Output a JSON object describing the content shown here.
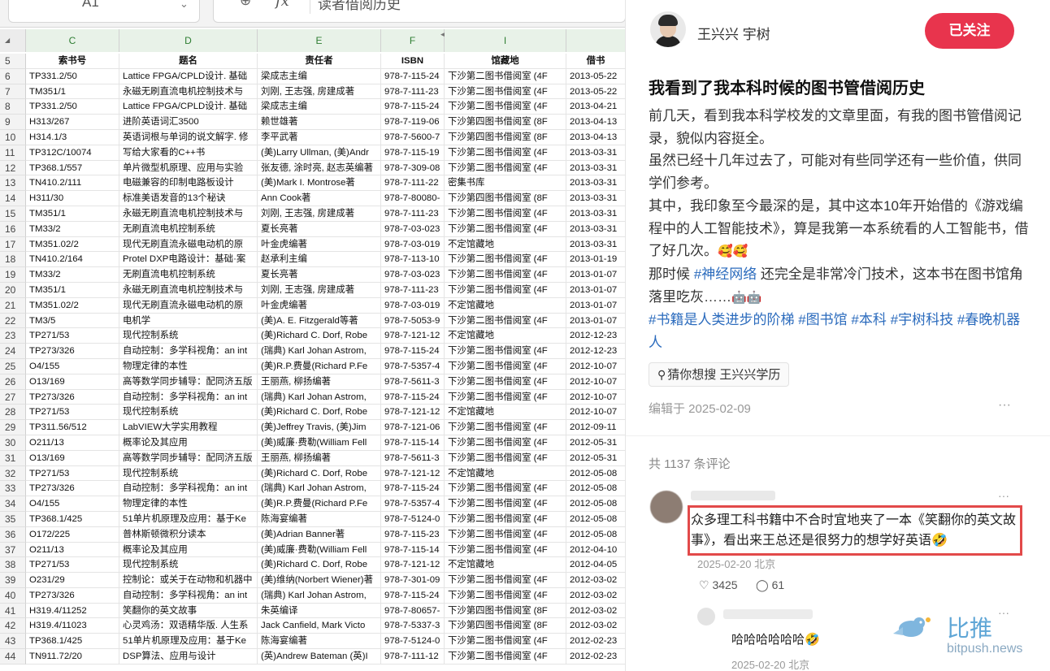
{
  "sheet": {
    "namebox": "A1",
    "formula_value": "读者借阅历史",
    "columns": [
      "C",
      "D",
      "E",
      "F",
      "I"
    ],
    "rows": [
      {
        "n": "5",
        "c": "索书号",
        "d": "题名",
        "e": "责任者",
        "f": "ISBN",
        "i": "馆藏地",
        "j": "借书"
      },
      {
        "n": "6",
        "c": "TP331.2/50",
        "d": "Lattice FPGA/CPLD设计. 基础",
        "e": "梁成志主编",
        "f": "978-7-115-24",
        "i": "下沙第二图书借阅室 (4F",
        "j": "2013-05-22"
      },
      {
        "n": "7",
        "c": "TM351/1",
        "d": "永磁无刷直流电机控制技术与",
        "e": "刘刚, 王志强, 房建成著",
        "f": "978-7-111-23",
        "i": "下沙第二图书借阅室 (4F",
        "j": "2013-05-22"
      },
      {
        "n": "8",
        "c": "TP331.2/50",
        "d": "Lattice FPGA/CPLD设计. 基础",
        "e": "梁成志主编",
        "f": "978-7-115-24",
        "i": "下沙第二图书借阅室 (4F",
        "j": "2013-04-21"
      },
      {
        "n": "9",
        "c": "H313/267",
        "d": "进阶英语词汇3500",
        "e": "赖世雄著",
        "f": "978-7-119-06",
        "i": "下沙第四图书借阅室 (8F",
        "j": "2013-04-13"
      },
      {
        "n": "10",
        "c": "H314.1/3",
        "d": "英语词根与单词的说文解字. 修",
        "e": "李平武著",
        "f": "978-7-5600-7",
        "i": "下沙第四图书借阅室 (8F",
        "j": "2013-04-13"
      },
      {
        "n": "11",
        "c": "TP312C/10074",
        "d": "写给大家看的C++书",
        "e": "(美)Larry Ullman, (美)Andr",
        "f": "978-7-115-19",
        "i": "下沙第二图书借阅室 (4F",
        "j": "2013-03-31"
      },
      {
        "n": "12",
        "c": "TP368.1/557",
        "d": "单片微型机原理、应用与实验",
        "e": "张友德, 涂时亮, 赵志英编著",
        "f": "978-7-309-08",
        "i": "下沙第二图书借阅室 (4F",
        "j": "2013-03-31"
      },
      {
        "n": "13",
        "c": "TN410.2/111",
        "d": "电磁兼容的印制电路板设计",
        "e": "(美)Mark I. Montrose著",
        "f": "978-7-111-22",
        "i": "密集书库",
        "j": "2013-03-31"
      },
      {
        "n": "14",
        "c": "H311/30",
        "d": "标准美语发音的13个秘诀",
        "e": "Ann Cook著",
        "f": "978-7-80080-",
        "i": "下沙第四图书借阅室 (8F",
        "j": "2013-03-31"
      },
      {
        "n": "15",
        "c": "TM351/1",
        "d": "永磁无刷直流电机控制技术与",
        "e": "刘刚, 王志强, 房建成著",
        "f": "978-7-111-23",
        "i": "下沙第二图书借阅室 (4F",
        "j": "2013-03-31"
      },
      {
        "n": "16",
        "c": "TM33/2",
        "d": "无刷直流电机控制系统",
        "e": "夏长亮著",
        "f": "978-7-03-023",
        "i": "下沙第二图书借阅室 (4F",
        "j": "2013-03-31"
      },
      {
        "n": "17",
        "c": "TM351.02/2",
        "d": "现代无刷直流永磁电动机的原",
        "e": "叶金虎编著",
        "f": "978-7-03-019",
        "i": "不定馆藏地",
        "j": "2013-03-31"
      },
      {
        "n": "18",
        "c": "TN410.2/164",
        "d": "Protel DXP电路设计：基础·案",
        "e": "赵承利主编",
        "f": "978-7-113-10",
        "i": "下沙第二图书借阅室 (4F",
        "j": "2013-01-19"
      },
      {
        "n": "19",
        "c": "TM33/2",
        "d": "无刷直流电机控制系统",
        "e": "夏长亮著",
        "f": "978-7-03-023",
        "i": "下沙第二图书借阅室 (4F",
        "j": "2013-01-07"
      },
      {
        "n": "20",
        "c": "TM351/1",
        "d": "永磁无刷直流电机控制技术与",
        "e": "刘刚, 王志强, 房建成著",
        "f": "978-7-111-23",
        "i": "下沙第二图书借阅室 (4F",
        "j": "2013-01-07"
      },
      {
        "n": "21",
        "c": "TM351.02/2",
        "d": "现代无刷直流永磁电动机的原",
        "e": "叶金虎编著",
        "f": "978-7-03-019",
        "i": "不定馆藏地",
        "j": "2013-01-07"
      },
      {
        "n": "22",
        "c": "TM3/5",
        "d": "电机学",
        "e": "(美)A. E. Fitzgerald等著",
        "f": "978-7-5053-9",
        "i": "下沙第二图书借阅室 (4F",
        "j": "2013-01-07"
      },
      {
        "n": "23",
        "c": "TP271/53",
        "d": "现代控制系统",
        "e": "(美)Richard C. Dorf, Robe",
        "f": "978-7-121-12",
        "i": "不定馆藏地",
        "j": "2012-12-23"
      },
      {
        "n": "24",
        "c": "TP273/326",
        "d": "自动控制：多学科视角：an int",
        "e": "(瑞典) Karl Johan Astrom,",
        "f": "978-7-115-24",
        "i": "下沙第二图书借阅室 (4F",
        "j": "2012-12-23"
      },
      {
        "n": "25",
        "c": "O4/155",
        "d": "物理定律的本性",
        "e": "(美)R.P.费曼(Richard P.Fe",
        "f": "978-7-5357-4",
        "i": "下沙第二图书借阅室 (4F",
        "j": "2012-10-07"
      },
      {
        "n": "26",
        "c": "O13/169",
        "d": "高等数学同步辅导：配同济五版",
        "e": "王丽燕, 柳扬编著",
        "f": "978-7-5611-3",
        "i": "下沙第二图书借阅室 (4F",
        "j": "2012-10-07"
      },
      {
        "n": "27",
        "c": "TP273/326",
        "d": "自动控制：多学科视角：an int",
        "e": "(瑞典) Karl Johan Astrom,",
        "f": "978-7-115-24",
        "i": "下沙第二图书借阅室 (4F",
        "j": "2012-10-07"
      },
      {
        "n": "28",
        "c": "TP271/53",
        "d": "现代控制系统",
        "e": "(美)Richard C. Dorf, Robe",
        "f": "978-7-121-12",
        "i": "不定馆藏地",
        "j": "2012-10-07"
      },
      {
        "n": "29",
        "c": "TP311.56/512",
        "d": "LabVIEW大学实用教程",
        "e": "(美)Jeffrey Travis, (美)Jim",
        "f": "978-7-121-06",
        "i": "下沙第二图书借阅室 (4F",
        "j": "2012-09-11"
      },
      {
        "n": "30",
        "c": "O211/13",
        "d": "概率论及其应用",
        "e": "(美)威廉·费勒(William Fell",
        "f": "978-7-115-14",
        "i": "下沙第二图书借阅室 (4F",
        "j": "2012-05-31"
      },
      {
        "n": "31",
        "c": "O13/169",
        "d": "高等数学同步辅导：配同济五版",
        "e": "王丽燕, 柳扬编著",
        "f": "978-7-5611-3",
        "i": "下沙第二图书借阅室 (4F",
        "j": "2012-05-31"
      },
      {
        "n": "32",
        "c": "TP271/53",
        "d": "现代控制系统",
        "e": "(美)Richard C. Dorf, Robe",
        "f": "978-7-121-12",
        "i": "不定馆藏地",
        "j": "2012-05-08"
      },
      {
        "n": "33",
        "c": "TP273/326",
        "d": "自动控制：多学科视角：an int",
        "e": "(瑞典) Karl Johan Astrom,",
        "f": "978-7-115-24",
        "i": "下沙第二图书借阅室 (4F",
        "j": "2012-05-08"
      },
      {
        "n": "34",
        "c": "O4/155",
        "d": "物理定律的本性",
        "e": "(美)R.P.费曼(Richard P.Fe",
        "f": "978-7-5357-4",
        "i": "下沙第二图书借阅室 (4F",
        "j": "2012-05-08"
      },
      {
        "n": "35",
        "c": "TP368.1/425",
        "d": "51单片机原理及应用：基于Ke",
        "e": "陈海宴编著",
        "f": "978-7-5124-0",
        "i": "下沙第二图书借阅室 (4F",
        "j": "2012-05-08"
      },
      {
        "n": "36",
        "c": "O172/225",
        "d": "普林斯顿微积分读本",
        "e": "(美)Adrian Banner著",
        "f": "978-7-115-23",
        "i": "下沙第二图书借阅室 (4F",
        "j": "2012-05-08"
      },
      {
        "n": "37",
        "c": "O211/13",
        "d": "概率论及其应用",
        "e": "(美)威廉·费勒(William Fell",
        "f": "978-7-115-14",
        "i": "下沙第二图书借阅室 (4F",
        "j": "2012-04-10"
      },
      {
        "n": "38",
        "c": "TP271/53",
        "d": "现代控制系统",
        "e": "(美)Richard C. Dorf, Robe",
        "f": "978-7-121-12",
        "i": "不定馆藏地",
        "j": "2012-04-05"
      },
      {
        "n": "39",
        "c": "O231/29",
        "d": "控制论：或关于在动物和机器中",
        "e": "(美)维纳(Norbert Wiener)著",
        "f": "978-7-301-09",
        "i": "下沙第二图书借阅室 (4F",
        "j": "2012-03-02"
      },
      {
        "n": "40",
        "c": "TP273/326",
        "d": "自动控制：多学科视角：an int",
        "e": "(瑞典) Karl Johan Astrom,",
        "f": "978-7-115-24",
        "i": "下沙第二图书借阅室 (4F",
        "j": "2012-03-02"
      },
      {
        "n": "41",
        "c": "H319.4/11252",
        "d": "笑翻你的英文故事",
        "e": "朱英编译",
        "f": "978-7-80657-",
        "i": "下沙第四图书借阅室 (8F",
        "j": "2012-03-02"
      },
      {
        "n": "42",
        "c": "H319.4/11023",
        "d": "心灵鸡汤：双语精华版. 人生系",
        "e": "Jack Canfield, Mark Victo",
        "f": "978-7-5337-3",
        "i": "下沙第四图书借阅室 (8F",
        "j": "2012-03-02"
      },
      {
        "n": "43",
        "c": "TP368.1/425",
        "d": "51单片机原理及应用：基于Ke",
        "e": "陈海宴编著",
        "f": "978-7-5124-0",
        "i": "下沙第二图书借阅室 (4F",
        "j": "2012-02-23"
      },
      {
        "n": "44",
        "c": "TN911.72/20",
        "d": "DSP算法、应用与设计",
        "e": "(英)Andrew Bateman (英)I",
        "f": "978-7-111-12",
        "i": "下沙第二图书借阅室 (4F",
        "j": "2012-02-23"
      }
    ]
  },
  "post": {
    "author": "王兴兴 宇树",
    "follow_label": "已关注",
    "title": "我看到了我本科时候的图书管借阅历史",
    "para1": "前几天，看到我本科学校发的文章里面，有我的图书管借阅记录，貌似内容挺全。",
    "para2": "虽然已经十几年过去了，可能对有些同学还有一些价值，供同学们参考。",
    "para3": "其中，我印象至今最深的是，其中这本10年开始借的《游戏编程中的人工智能技术》，算是我第一本系统看的人工智能书，借了好几次。",
    "para3_emoji": "🥰🥰",
    "para4_pre": "那时候 ",
    "para4_tag": "#神经网络",
    "para4_post": " 还完全是非常冷门技术，这本书在图书馆角落里吃灰……",
    "para4_emoji": "🤖🤖",
    "tags": [
      "#书籍是人类进步的阶梯",
      "#图书馆",
      "#本科",
      "#宇树科技",
      "#春晚机器人"
    ],
    "search_chip": "猜你想搜 王兴兴学历",
    "edited": "编辑于 2025-02-09",
    "more": "···",
    "comment_count": "共 1137 条评论",
    "comment1": {
      "text": "众多理工科书籍中不合时宜地夹了一本《笑翻你的英文故事》，看出来王总还是很努力的想学好英语🤣",
      "meta": "2025-02-20 北京",
      "likes": "3425",
      "replies": "61"
    },
    "comment2": {
      "text": "哈哈哈哈哈哈🤣",
      "meta": "2025-02-20 北京"
    },
    "watermark_cn": "比推",
    "watermark_en": "bitpush.news"
  },
  "colors": {
    "accent_red": "#e8344d",
    "hashtag_blue": "#2b6bbd",
    "sheet_green": "#2e7d32",
    "highlight_border": "#e24a4a"
  }
}
